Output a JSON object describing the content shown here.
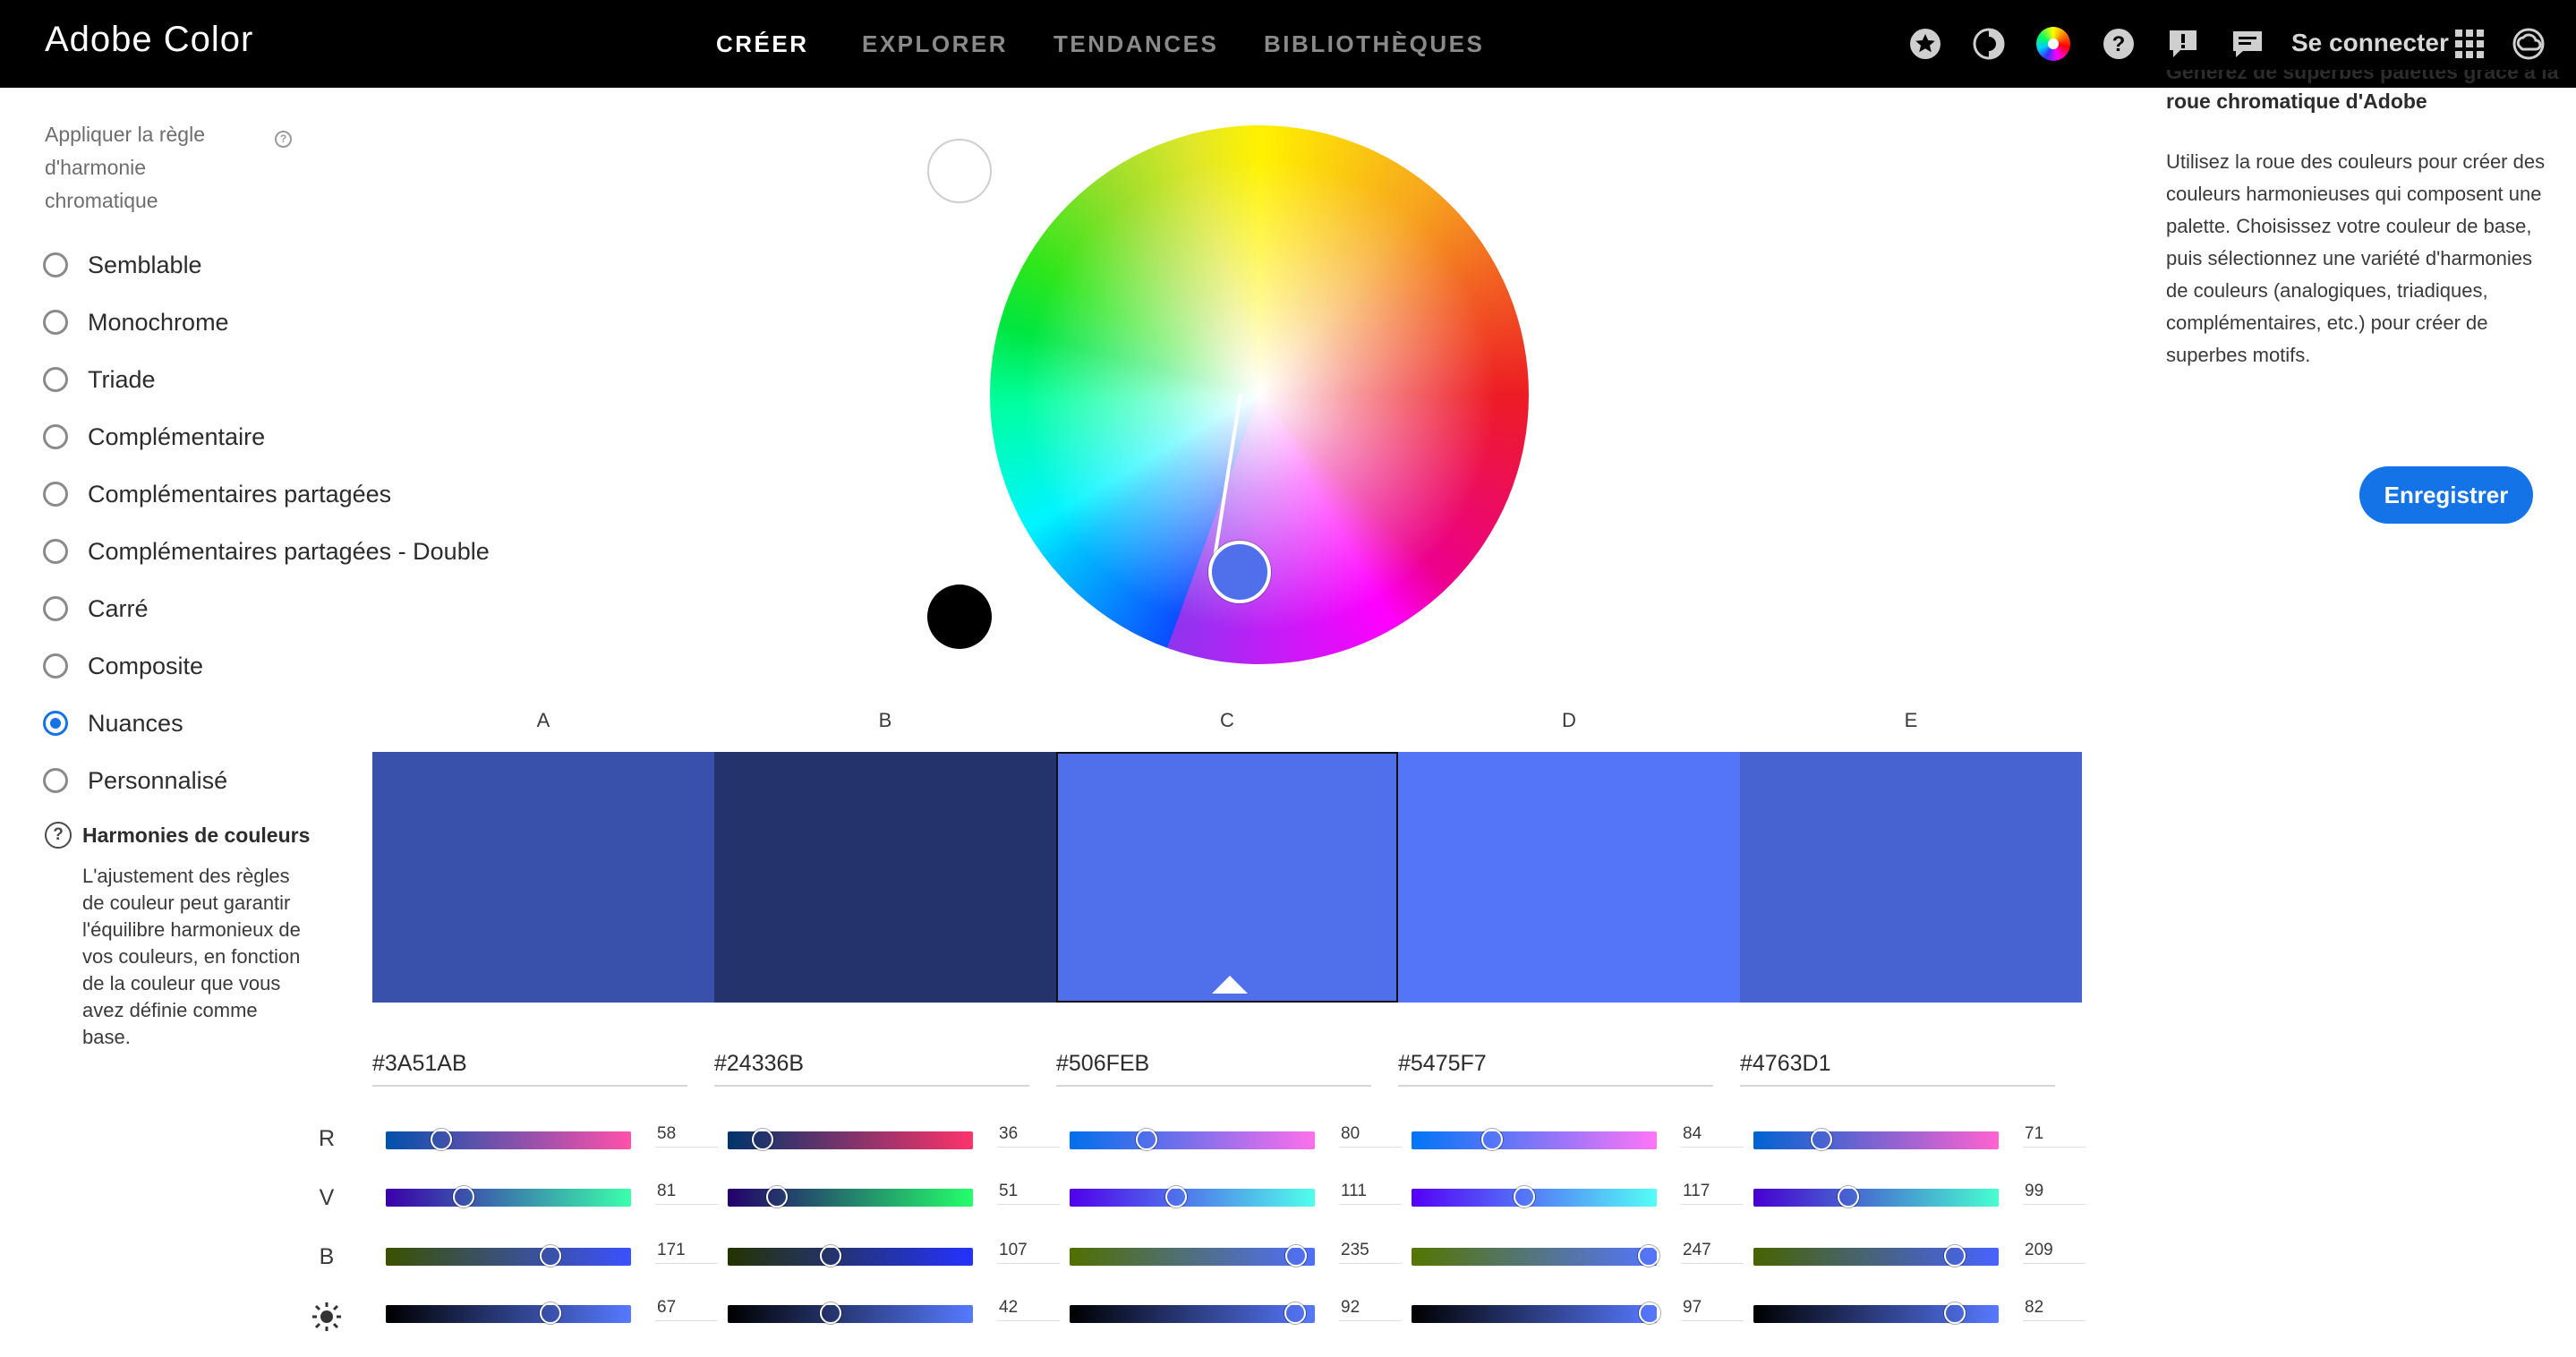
{
  "app": {
    "title": "Adobe Color"
  },
  "nav": {
    "tabs": [
      {
        "label": "CRÉER",
        "active": true
      },
      {
        "label": "EXPLORER",
        "active": false
      },
      {
        "label": "TENDANCES",
        "active": false
      },
      {
        "label": "BIBLIOTHÈQUES",
        "active": false
      }
    ],
    "icons": [
      "star-icon",
      "contrast-icon",
      "color-wheel-icon",
      "help-icon",
      "feedback-icon",
      "chat-icon"
    ],
    "signin_label": "Se connecter",
    "apps_icon": "apps-grid-icon",
    "cc_icon": "creative-cloud-icon"
  },
  "left_panel": {
    "rule_title": "Appliquer la règle d'harmonie chromatique",
    "rules": [
      {
        "label": "Semblable",
        "checked": false
      },
      {
        "label": "Monochrome",
        "checked": false
      },
      {
        "label": "Triade",
        "checked": false
      },
      {
        "label": "Complémentaire",
        "checked": false
      },
      {
        "label": "Complémentaires partagées",
        "checked": false
      },
      {
        "label": "Complémentaires partagées - Double",
        "checked": false
      },
      {
        "label": "Carré",
        "checked": false
      },
      {
        "label": "Composite",
        "checked": false
      },
      {
        "label": "Nuances",
        "checked": true
      },
      {
        "label": "Personnalisé",
        "checked": false
      }
    ],
    "help_title": "Harmonies de couleurs",
    "help_text": "L'ajustement des règles de couleur peut garantir l'équilibre harmonieux de vos couleurs, en fonction de la couleur que vous avez définie comme base."
  },
  "swatches": [
    {
      "letter": "A",
      "hex": "#3A51AB",
      "color": "#3A51AB",
      "selected": false,
      "r": 58,
      "v": 81,
      "b": 171,
      "brightness": 67
    },
    {
      "letter": "B",
      "hex": "#24336B",
      "color": "#24336B",
      "selected": false,
      "r": 36,
      "v": 51,
      "b": 107,
      "brightness": 42
    },
    {
      "letter": "C",
      "hex": "#506FEB",
      "color": "#506FEB",
      "selected": true,
      "r": 80,
      "v": 111,
      "b": 235,
      "brightness": 92
    },
    {
      "letter": "D",
      "hex": "#5475F7",
      "color": "#5475F7",
      "selected": false,
      "r": 84,
      "v": 117,
      "b": 247,
      "brightness": 97
    },
    {
      "letter": "E",
      "hex": "#4763D1",
      "color": "#4763D1",
      "selected": false,
      "r": 71,
      "v": 99,
      "b": 209,
      "brightness": 82
    }
  ],
  "channels": {
    "r": "R",
    "v": "V",
    "b": "B",
    "brightness_icon": "brightness-icon"
  },
  "right_panel": {
    "title": "Générez de superbes palettes grâce à la roue chromatique d'Adobe",
    "text": "Utilisez la roue des couleurs pour créer des couleurs harmonieuses qui composent une palette. Choisissez votre couleur de base, puis sélectionnez une variété d'harmonies de couleurs (analogiques, triadiques, complémentaires, etc.) pour créer de superbes motifs.",
    "save_label": "Enregistrer"
  },
  "colors": {
    "accent": "#1473e6",
    "nav_bg": "#000000"
  }
}
